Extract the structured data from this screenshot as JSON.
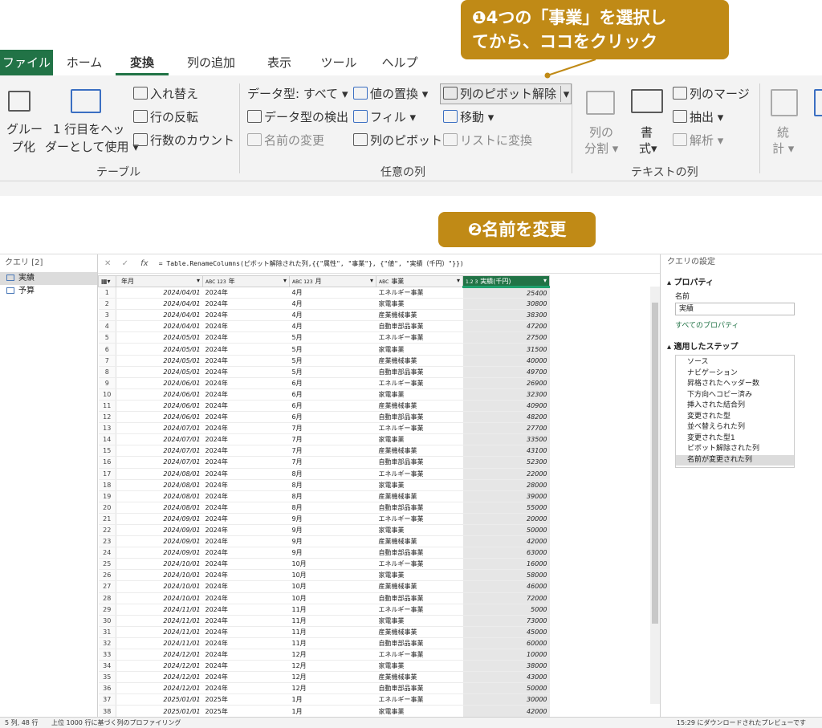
{
  "ribbon": {
    "tabs": [
      "ファイル",
      "ホーム",
      "変換",
      "列の追加",
      "表示",
      "ツール",
      "ヘルプ"
    ],
    "group_left": {
      "btn_group_line1": "グルー",
      "btn_group_line2": "プ化",
      "btn_header_line1": "1 行目をヘッ",
      "btn_header_line2": "ダーとして使用",
      "swap": "入れ替え",
      "reverse": "行の反転",
      "count": "行数のカウント",
      "label": "テーブル"
    },
    "group_any": {
      "dtype": "データ型: すべて",
      "detect": "データ型の検出",
      "rename": "名前の変更",
      "replace": "値の置換",
      "fill": "フィル",
      "pivot": "列のピボット",
      "unpivot": "列のピボット解除",
      "move": "移動",
      "tolist": "リストに変換",
      "label": "任意の列"
    },
    "group_text": {
      "split_line1": "列の",
      "split_line2": "分割",
      "format_line1": "書",
      "format_line2": "式",
      "merge": "列のマージ",
      "extract": "抽出",
      "parse": "解析",
      "label": "テキストの列"
    },
    "group_num": {
      "stats_line1": "統",
      "stats_line2": "計"
    }
  },
  "callouts": {
    "first_line1": "❶4つの「事業」を選択し",
    "first_line2": "てから、ココをクリック",
    "second": "❷名前を変更"
  },
  "query_panel": {
    "title": "クエリ [2]",
    "items": [
      "実績",
      "予算"
    ]
  },
  "formula": {
    "text": "= Table.RenameColumns(ピボット解除された列,{{\"属性\", \"事業\"}, {\"値\", \"実績（千円）\"}})"
  },
  "columns": [
    "年月",
    "年",
    "月",
    "事業",
    "実績(千円)"
  ],
  "column_types": [
    "",
    "ABC 123",
    "ABC 123",
    "ABC",
    "1.2 3"
  ],
  "rows": [
    [
      "2024/04/01",
      "2024年",
      "4月",
      "エネルギー事業",
      "25400"
    ],
    [
      "2024/04/01",
      "2024年",
      "4月",
      "家電事業",
      "30800"
    ],
    [
      "2024/04/01",
      "2024年",
      "4月",
      "産業機械事業",
      "38300"
    ],
    [
      "2024/04/01",
      "2024年",
      "4月",
      "自動車部品事業",
      "47200"
    ],
    [
      "2024/05/01",
      "2024年",
      "5月",
      "エネルギー事業",
      "27500"
    ],
    [
      "2024/05/01",
      "2024年",
      "5月",
      "家電事業",
      "31500"
    ],
    [
      "2024/05/01",
      "2024年",
      "5月",
      "産業機械事業",
      "40000"
    ],
    [
      "2024/05/01",
      "2024年",
      "5月",
      "自動車部品事業",
      "49700"
    ],
    [
      "2024/06/01",
      "2024年",
      "6月",
      "エネルギー事業",
      "26900"
    ],
    [
      "2024/06/01",
      "2024年",
      "6月",
      "家電事業",
      "32300"
    ],
    [
      "2024/06/01",
      "2024年",
      "6月",
      "産業機械事業",
      "40900"
    ],
    [
      "2024/06/01",
      "2024年",
      "6月",
      "自動車部品事業",
      "48200"
    ],
    [
      "2024/07/01",
      "2024年",
      "7月",
      "エネルギー事業",
      "27700"
    ],
    [
      "2024/07/01",
      "2024年",
      "7月",
      "家電事業",
      "33500"
    ],
    [
      "2024/07/01",
      "2024年",
      "7月",
      "産業機械事業",
      "43100"
    ],
    [
      "2024/07/01",
      "2024年",
      "7月",
      "自動車部品事業",
      "52300"
    ],
    [
      "2024/08/01",
      "2024年",
      "8月",
      "エネルギー事業",
      "22000"
    ],
    [
      "2024/08/01",
      "2024年",
      "8月",
      "家電事業",
      "28000"
    ],
    [
      "2024/08/01",
      "2024年",
      "8月",
      "産業機械事業",
      "39000"
    ],
    [
      "2024/08/01",
      "2024年",
      "8月",
      "自動車部品事業",
      "55000"
    ],
    [
      "2024/09/01",
      "2024年",
      "9月",
      "エネルギー事業",
      "20000"
    ],
    [
      "2024/09/01",
      "2024年",
      "9月",
      "家電事業",
      "50000"
    ],
    [
      "2024/09/01",
      "2024年",
      "9月",
      "産業機械事業",
      "42000"
    ],
    [
      "2024/09/01",
      "2024年",
      "9月",
      "自動車部品事業",
      "63000"
    ],
    [
      "2024/10/01",
      "2024年",
      "10月",
      "エネルギー事業",
      "16000"
    ],
    [
      "2024/10/01",
      "2024年",
      "10月",
      "家電事業",
      "58000"
    ],
    [
      "2024/10/01",
      "2024年",
      "10月",
      "産業機械事業",
      "46000"
    ],
    [
      "2024/10/01",
      "2024年",
      "10月",
      "自動車部品事業",
      "72000"
    ],
    [
      "2024/11/01",
      "2024年",
      "11月",
      "エネルギー事業",
      "5000"
    ],
    [
      "2024/11/01",
      "2024年",
      "11月",
      "家電事業",
      "73000"
    ],
    [
      "2024/11/01",
      "2024年",
      "11月",
      "産業機械事業",
      "45000"
    ],
    [
      "2024/11/01",
      "2024年",
      "11月",
      "自動車部品事業",
      "60000"
    ],
    [
      "2024/12/01",
      "2024年",
      "12月",
      "エネルギー事業",
      "10000"
    ],
    [
      "2024/12/01",
      "2024年",
      "12月",
      "家電事業",
      "38000"
    ],
    [
      "2024/12/01",
      "2024年",
      "12月",
      "産業機械事業",
      "43000"
    ],
    [
      "2024/12/01",
      "2024年",
      "12月",
      "自動車部品事業",
      "50000"
    ],
    [
      "2025/01/01",
      "2025年",
      "1月",
      "エネルギー事業",
      "30000"
    ],
    [
      "2025/01/01",
      "2025年",
      "1月",
      "家電事業",
      "42000"
    ]
  ],
  "settings": {
    "title": "クエリの設定",
    "props_header": "プロパティ",
    "name_label": "名前",
    "name_value": "実績",
    "all_props": "すべてのプロパティ",
    "steps_header": "適用したステップ",
    "steps": [
      "ソース",
      "ナビゲーション",
      "昇格されたヘッダー数",
      "下方向へコピー済み",
      "挿入された結合列",
      "変更された型",
      "並べ替えられた列",
      "変更された型1",
      "ピボット解除された列",
      "名前が変更された列"
    ]
  },
  "status": {
    "left": "5 列, 48 行",
    "profile": "上位 1000 行に基づく列のプロファイリング",
    "right": "15:29 にダウンロードされたプレビューです"
  },
  "colors": {
    "accent": "#217346",
    "callout": "#c08a16"
  }
}
